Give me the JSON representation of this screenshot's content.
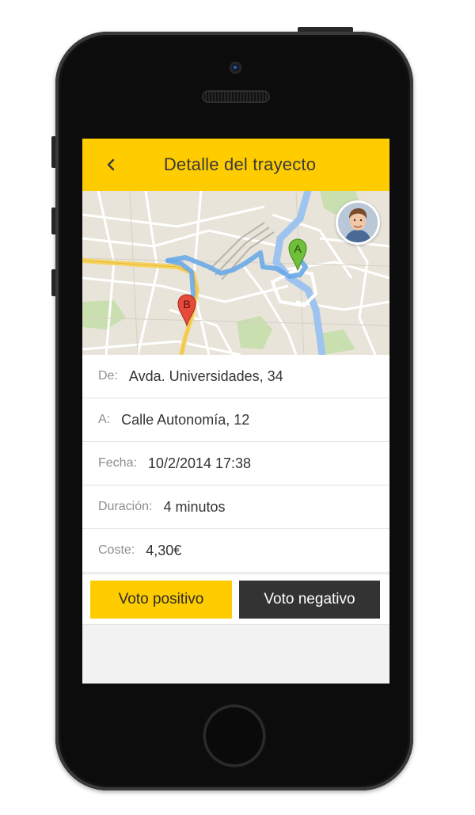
{
  "header": {
    "title": "Detalle del trayecto",
    "back_icon": "chevron-left-icon",
    "background": "#ffcc00"
  },
  "map": {
    "marker_a": "A",
    "marker_b": "B",
    "marker_a_color": "#6fbf3a",
    "marker_b_color": "#e64a3c",
    "route_color": "#6aa8e8"
  },
  "trip": {
    "from_label": "De:",
    "from_value": "Avda. Universidades, 34",
    "to_label": "A:",
    "to_value": "Calle Autonomía, 12",
    "date_label": "Fecha:",
    "date_value": "10/2/2014 17:38",
    "duration_label": "Duración:",
    "duration_value": "4 minutos",
    "cost_label": "Coste:",
    "cost_value": "4,30€"
  },
  "actions": {
    "upvote_label": "Voto positivo",
    "downvote_label": "Voto negativo"
  }
}
